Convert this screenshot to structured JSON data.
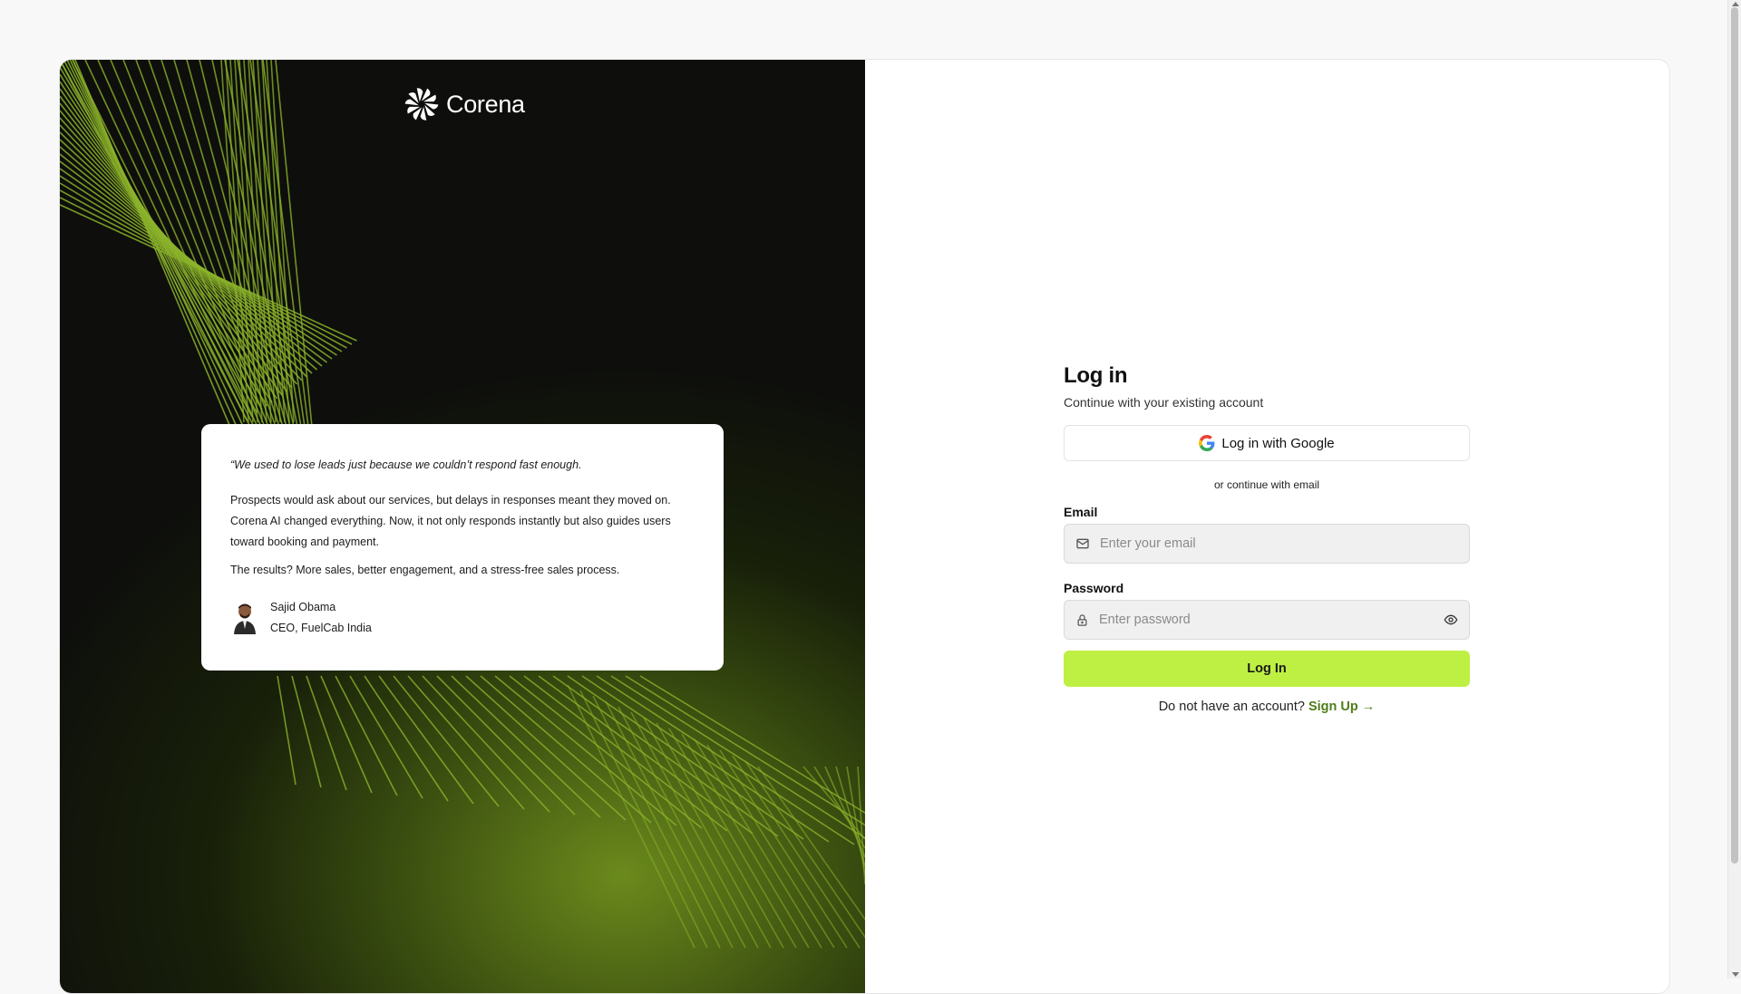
{
  "brand": {
    "name": "Corena",
    "logo_icon": "pinwheel-logo-icon"
  },
  "testimonial": {
    "quote": "“We used to lose leads just because we couldn’t respond fast enough.",
    "paragraph1": "Prospects would ask about our services, but delays in responses meant they moved on. Corena AI changed everything. Now, it not only responds instantly but also guides users toward booking and payment.",
    "paragraph2": "The results? More sales, better engagement, and a stress-free sales process.",
    "author_name": "Sajid Obama",
    "author_title": "CEO, FuelCab India"
  },
  "login": {
    "title": "Log in",
    "subtitle": "Continue with your existing account",
    "google_button": "Log in with Google",
    "divider": "or continue with email",
    "email_label": "Email",
    "email_placeholder": "Enter your email",
    "email_icon": "mail-icon",
    "password_label": "Password",
    "password_placeholder": "Enter password",
    "password_icon": "lock-icon",
    "toggle_icon": "eye-icon",
    "submit": "Log In",
    "signup_prompt": "Do not have an account?",
    "signup_link": "Sign Up →"
  },
  "colors": {
    "accent": "#bef043",
    "link": "#4f7d1a",
    "panel_dark": "#0e0f0c",
    "line_green": "#8bb32a"
  }
}
